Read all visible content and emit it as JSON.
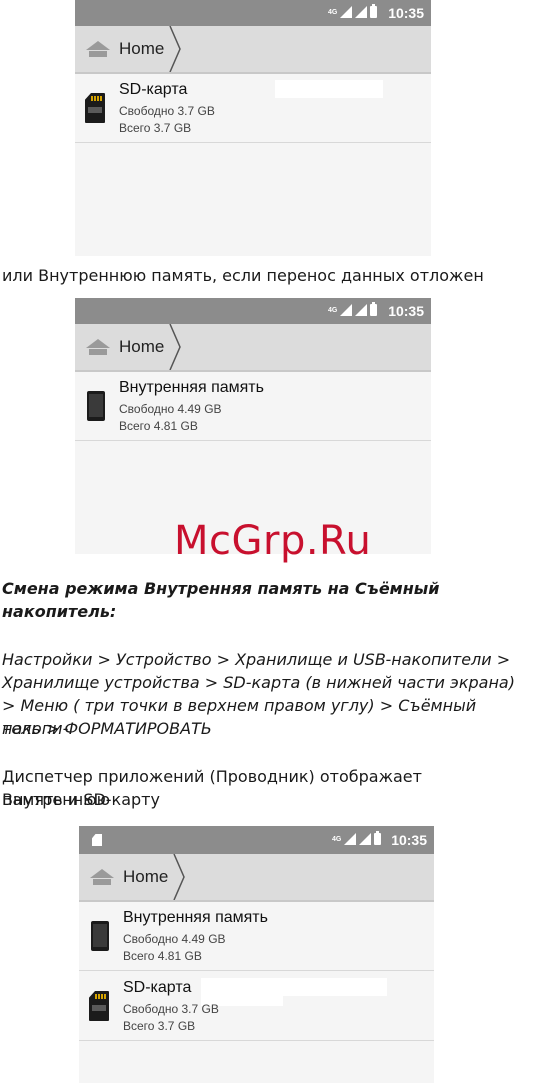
{
  "screens": [
    {
      "status": {
        "net": "4G",
        "time": "10:35"
      },
      "breadcrumb": "Home",
      "items": [
        {
          "icon": "sd-card-icon",
          "title": "SD-карта",
          "free": "Свободно 3.7 GB",
          "total": "Всего 3.7 GB"
        }
      ]
    },
    {
      "status": {
        "net": "4G",
        "time": "10:35"
      },
      "breadcrumb": "Home",
      "items": [
        {
          "icon": "phone-icon",
          "title": "Внутренняя память",
          "free": "Свободно 4.49 GB",
          "total": "Всего 4.81 GB"
        }
      ]
    },
    {
      "status": {
        "net": "4G",
        "time": "10:35"
      },
      "breadcrumb": "Home",
      "items": [
        {
          "icon": "phone-icon",
          "title": "Внутренняя память",
          "free": "Свободно 4.49 GB",
          "total": "Всего 4.81 GB"
        },
        {
          "icon": "sd-card-icon",
          "title": "SD-карта",
          "free": "Свободно 3.7 GB",
          "total": "Всего 3.7 GB"
        }
      ]
    }
  ],
  "text": {
    "line1": "или Внутреннюю память, если перенос данных отложен",
    "heading1": "Смена режима Внутренняя память на Съёмный",
    "heading2": "накопитель:",
    "para1_l1": "Настройки > Устройство > Хранилище и USB-накопители >",
    "para1_l2": "Хранилище устройства  > SD-карта  (в нижней части экрана)",
    "para1_l3": "> Меню ( три точки в верхнем правом углу) > Съёмный накопи-",
    "para1_l4": "тель > ФОРМАТИРОВАТЬ",
    "para2_l1": "Диспетчер приложений (Проводник) отображает Внутреннюю",
    "para2_l2": "память и SD-карту"
  },
  "watermark": "McGrp.Ru"
}
